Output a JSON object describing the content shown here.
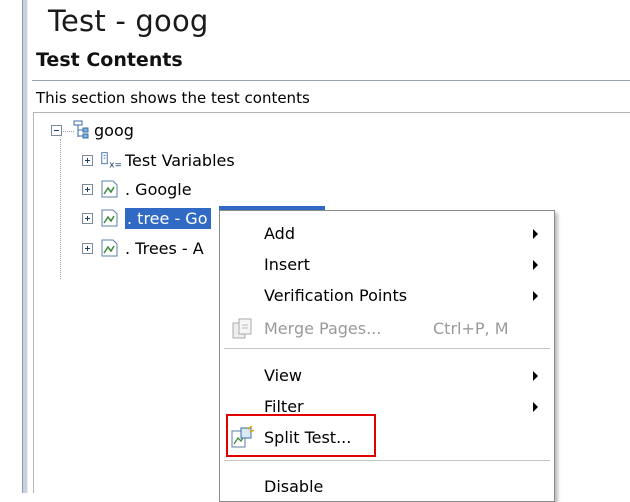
{
  "editor": {
    "title": "Test - goog",
    "section_header": "Test Contents",
    "section_description": "This section shows the test contents"
  },
  "tree": {
    "root": {
      "label": "goog",
      "expanded": true,
      "icon": "test-suite-icon"
    },
    "children": [
      {
        "label": "Test Variables",
        "icon": "test-variables-icon",
        "expanded": false
      },
      {
        "label": ". Google",
        "icon": "page-icon",
        "expanded": false
      },
      {
        "label": ". tree - Go",
        "icon": "page-icon",
        "expanded": false,
        "selected": true
      },
      {
        "label": ". Trees - A",
        "icon": "page-icon",
        "expanded": false
      }
    ]
  },
  "context_menu": {
    "items": [
      {
        "label": "Add",
        "submenu": true
      },
      {
        "label": "Insert",
        "submenu": true
      },
      {
        "label": "Verification Points",
        "submenu": true
      },
      {
        "label": "Merge Pages...",
        "shortcut": "Ctrl+P, M",
        "disabled": true,
        "icon": "merge-pages-icon"
      },
      {
        "label": "View",
        "submenu": true
      },
      {
        "label": "Filter",
        "submenu": true
      },
      {
        "label": "Split Test...",
        "icon": "split-test-icon",
        "highlighted": true
      },
      {
        "label": "Disable"
      }
    ]
  },
  "colors": {
    "selection": "#316ac5",
    "highlight_box": "#e00000",
    "disabled_text": "#9a9a9a"
  }
}
